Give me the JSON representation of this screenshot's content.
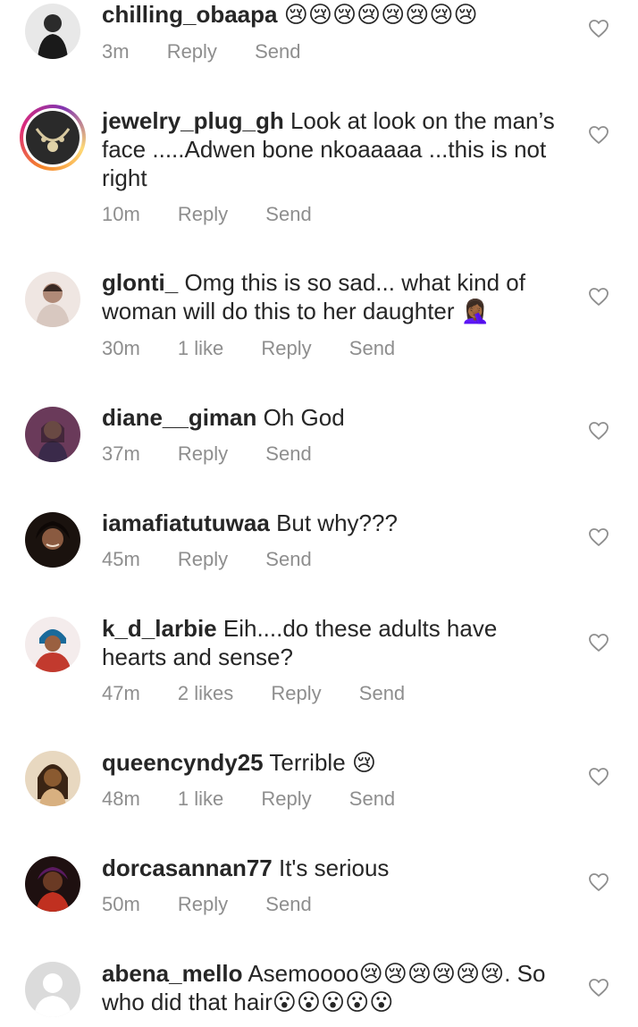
{
  "comments": [
    {
      "username": "chilling_obaapa",
      "text": "😢😢😢😢😢😢😢😢",
      "time": "3m",
      "likes": "",
      "reply_label": "Reply",
      "send_label": "Send",
      "avatar_color": "#2b2b2b"
    },
    {
      "username": "jewelry_plug_gh",
      "text": "Look at look on the man’s face .....Adwen bone nkoaaaaa ...this is not right",
      "time": "10m",
      "likes": "",
      "reply_label": "Reply",
      "send_label": "Send",
      "avatar_color": "#3a3a3a"
    },
    {
      "username": "glonti_",
      "text": "Omg this is so sad... what kind of woman will do this to her daughter 🤦🏾‍♀️",
      "time": "30m",
      "likes": "1 like",
      "reply_label": "Reply",
      "send_label": "Send",
      "avatar_color": "#b08a78"
    },
    {
      "username": "diane__giman",
      "text": "Oh God",
      "time": "37m",
      "likes": "",
      "reply_label": "Reply",
      "send_label": "Send",
      "avatar_color": "#7a4a6a"
    },
    {
      "username": "iamafiatutuwaa",
      "text": "But why???",
      "time": "45m",
      "likes": "",
      "reply_label": "Reply",
      "send_label": "Send",
      "avatar_color": "#2a1a14"
    },
    {
      "username": "k_d_larbie",
      "text": "Eih....do these adults have hearts and sense?",
      "time": "47m",
      "likes": "2 likes",
      "reply_label": "Reply",
      "send_label": "Send",
      "avatar_color": "#c23a2e"
    },
    {
      "username": "queencyndy25",
      "text": "Terrible 😢",
      "time": "48m",
      "likes": "1 like",
      "reply_label": "Reply",
      "send_label": "Send",
      "avatar_color": "#7a4a2a"
    },
    {
      "username": "dorcasannan77",
      "text": "It's serious",
      "time": "50m",
      "likes": "",
      "reply_label": "Reply",
      "send_label": "Send",
      "avatar_color": "#3a1a1a"
    },
    {
      "username": "abena_mello",
      "text": "Asemoooo😢😢😢😢😢😢. So who did that hair😮😮😮😮😮",
      "time": "",
      "likes": "",
      "reply_label": "",
      "send_label": "",
      "avatar_color": "#d9d9d9"
    }
  ],
  "colors": {
    "text": "#262626",
    "meta": "#8e8e8e",
    "heart_outline": "#8e8e8e",
    "story_ring": "#dd2a7b"
  },
  "icons": {
    "like": "heart-outline-icon"
  }
}
